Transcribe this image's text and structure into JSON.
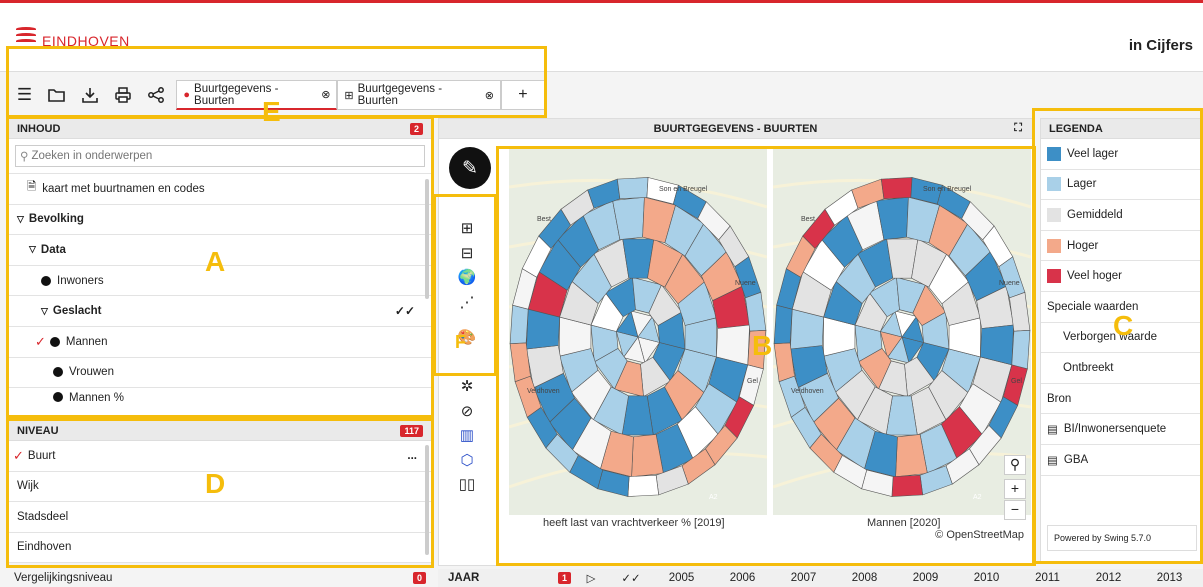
{
  "header": {
    "logo_text": "EINDHOVEN",
    "app_title": "in Cijfers"
  },
  "toolbar": {
    "icons": [
      "menu-icon",
      "folder-open-icon",
      "download-icon",
      "print-icon",
      "share-icon"
    ],
    "tabs": [
      {
        "label": "Buurtgegevens - Buurten",
        "icon": "map-pin-icon",
        "active": true
      },
      {
        "label": "Buurtgegevens - Buurten",
        "icon": "table-icon",
        "active": false
      }
    ],
    "add_label": "+"
  },
  "inhoud": {
    "title": "INHOUD",
    "badge": "2",
    "search_placeholder": "Zoeken in onderwerpen",
    "items": [
      {
        "label": "kaart met buurtnamen en codes"
      },
      {
        "label": "Bevolking"
      },
      {
        "label": "Data"
      },
      {
        "label": "Inwoners"
      },
      {
        "label": "Geslacht"
      },
      {
        "label": "Mannen"
      },
      {
        "label": "Vrouwen"
      },
      {
        "label": "Mannen %"
      }
    ]
  },
  "niveau": {
    "title": "NIVEAU",
    "badge": "117",
    "items": [
      {
        "label": "Buurt",
        "more": "..."
      },
      {
        "label": "Wijk"
      },
      {
        "label": "Stadsdeel"
      },
      {
        "label": "Eindhoven"
      }
    ],
    "vergelijk_label": "Vergelijkingsniveau",
    "vergelijk_badge": "0"
  },
  "center": {
    "title": "BUURTGEGEVENS - BUURTEN",
    "map1_caption": "heeft last van vrachtverkeer % [2019]",
    "map2_caption": "Mannen [2020]",
    "attribution": "© OpenStreetMap",
    "place_labels": [
      "Son en Breugel",
      "Best",
      "Nuene",
      "Veldhoven",
      "Gel"
    ],
    "road_label": "A2"
  },
  "legenda": {
    "title": "LEGENDA",
    "classes": [
      {
        "label": "Veel lager",
        "color": "#3d8fc6"
      },
      {
        "label": "Lager",
        "color": "#a9d0e8"
      },
      {
        "label": "Gemiddeld",
        "color": "#e3e3e3"
      },
      {
        "label": "Hoger",
        "color": "#f3a98a"
      },
      {
        "label": "Veel hoger",
        "color": "#d8334a"
      }
    ],
    "special_title": "Speciale waarden",
    "special": [
      "Verborgen waarde",
      "Ontbreekt"
    ],
    "bron_title": "Bron",
    "bron": [
      "BI/Inwonersenquete",
      "GBA"
    ],
    "powered": "Powered by Swing 5.7.0"
  },
  "timebar": {
    "label": "JAAR",
    "badge": "1",
    "years": [
      "2005",
      "2006",
      "2007",
      "2008",
      "2009",
      "2010",
      "2011",
      "2012",
      "2013"
    ]
  },
  "annotations": {
    "A": "A",
    "B": "B",
    "C": "C",
    "D": "D",
    "E": "E",
    "F": "F"
  }
}
